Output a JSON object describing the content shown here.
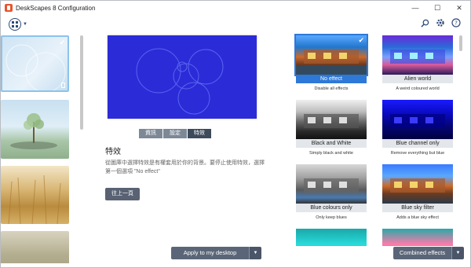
{
  "window": {
    "title": "DeskScapes 8 Configuration",
    "controls": [
      "—",
      "☐",
      "✕"
    ]
  },
  "toolbar": {
    "view_icon": "view-grid-icon",
    "right_icons": [
      "search-icon",
      "gear-icon",
      "help-icon"
    ]
  },
  "center": {
    "tabs": [
      "資訊",
      "設定",
      "特效"
    ],
    "active_tab": "特效",
    "section_title": "特效",
    "description": "從圖庫中選擇特效是有權套用於你的背景。要停止使用特效，選擇第一個選項 \"No effect\"",
    "back_label": "往上一頁",
    "apply_label": "Apply to my desktop"
  },
  "effects": {
    "items": [
      {
        "label": "No effect",
        "desc": "Disable all effects",
        "selected": true
      },
      {
        "label": "Alien world",
        "desc": "A weird coloured world",
        "selected": false
      },
      {
        "label": "Black and White",
        "desc": "Simply black and white",
        "selected": false
      },
      {
        "label": "Blue channel only",
        "desc": "Remove everything but blue",
        "selected": false
      },
      {
        "label": "Blue colours only",
        "desc": "Only keep blues",
        "selected": false
      },
      {
        "label": "Blue sky filter",
        "desc": "Adds a blue sky effect",
        "selected": false
      }
    ],
    "combined_label": "Combined effects"
  },
  "colors": {
    "accent": "#2e78d8",
    "preview_bg": "#2c2bd8",
    "button": "#5a6678"
  }
}
